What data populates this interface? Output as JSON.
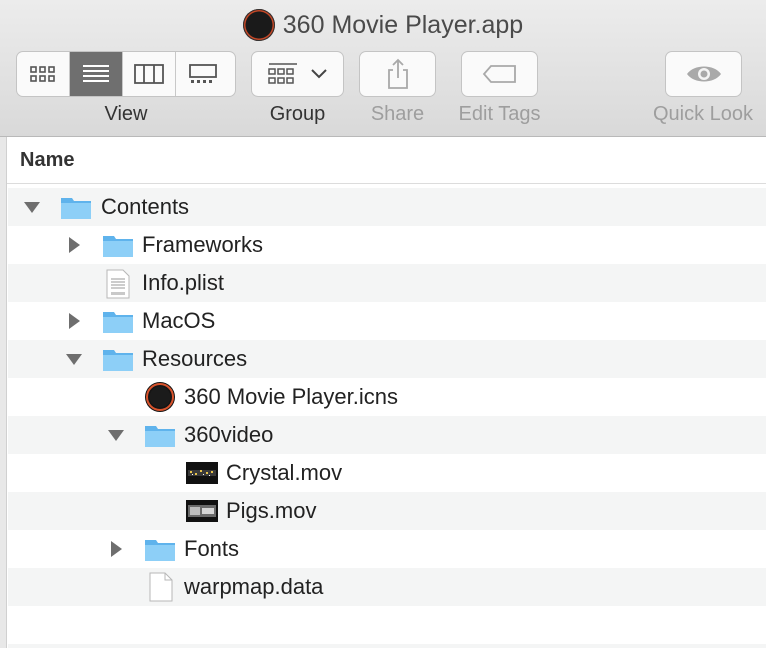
{
  "window": {
    "title": "360 Movie Player.app"
  },
  "toolbar": {
    "view_label": "View",
    "group_label": "Group",
    "share_label": "Share",
    "edit_tags_label": "Edit Tags",
    "quick_look_label": "Quick Look",
    "active_view": "list"
  },
  "list": {
    "column_name": "Name",
    "rows": [
      {
        "label": "Contents",
        "kind": "folder",
        "depth": 0,
        "disclosure": "expanded"
      },
      {
        "label": "Frameworks",
        "kind": "folder",
        "depth": 1,
        "disclosure": "collapsed"
      },
      {
        "label": "Info.plist",
        "kind": "plist",
        "depth": 1,
        "disclosure": "none"
      },
      {
        "label": "MacOS",
        "kind": "folder",
        "depth": 1,
        "disclosure": "collapsed"
      },
      {
        "label": "Resources",
        "kind": "folder",
        "depth": 1,
        "disclosure": "expanded"
      },
      {
        "label": "360 Movie Player.icns",
        "kind": "icns",
        "depth": 2,
        "disclosure": "none"
      },
      {
        "label": "360video",
        "kind": "folder",
        "depth": 2,
        "disclosure": "expanded"
      },
      {
        "label": "Crystal.mov",
        "kind": "movie",
        "depth": 3,
        "disclosure": "none"
      },
      {
        "label": "Pigs.mov",
        "kind": "movie",
        "depth": 3,
        "disclosure": "none"
      },
      {
        "label": "Fonts",
        "kind": "folder",
        "depth": 2,
        "disclosure": "collapsed"
      },
      {
        "label": "warpmap.data",
        "kind": "document",
        "depth": 2,
        "disclosure": "none"
      }
    ]
  },
  "colors": {
    "folder": "#7cc4f2",
    "stripe": "#f4f5f5",
    "toolbar": "#dedede"
  }
}
